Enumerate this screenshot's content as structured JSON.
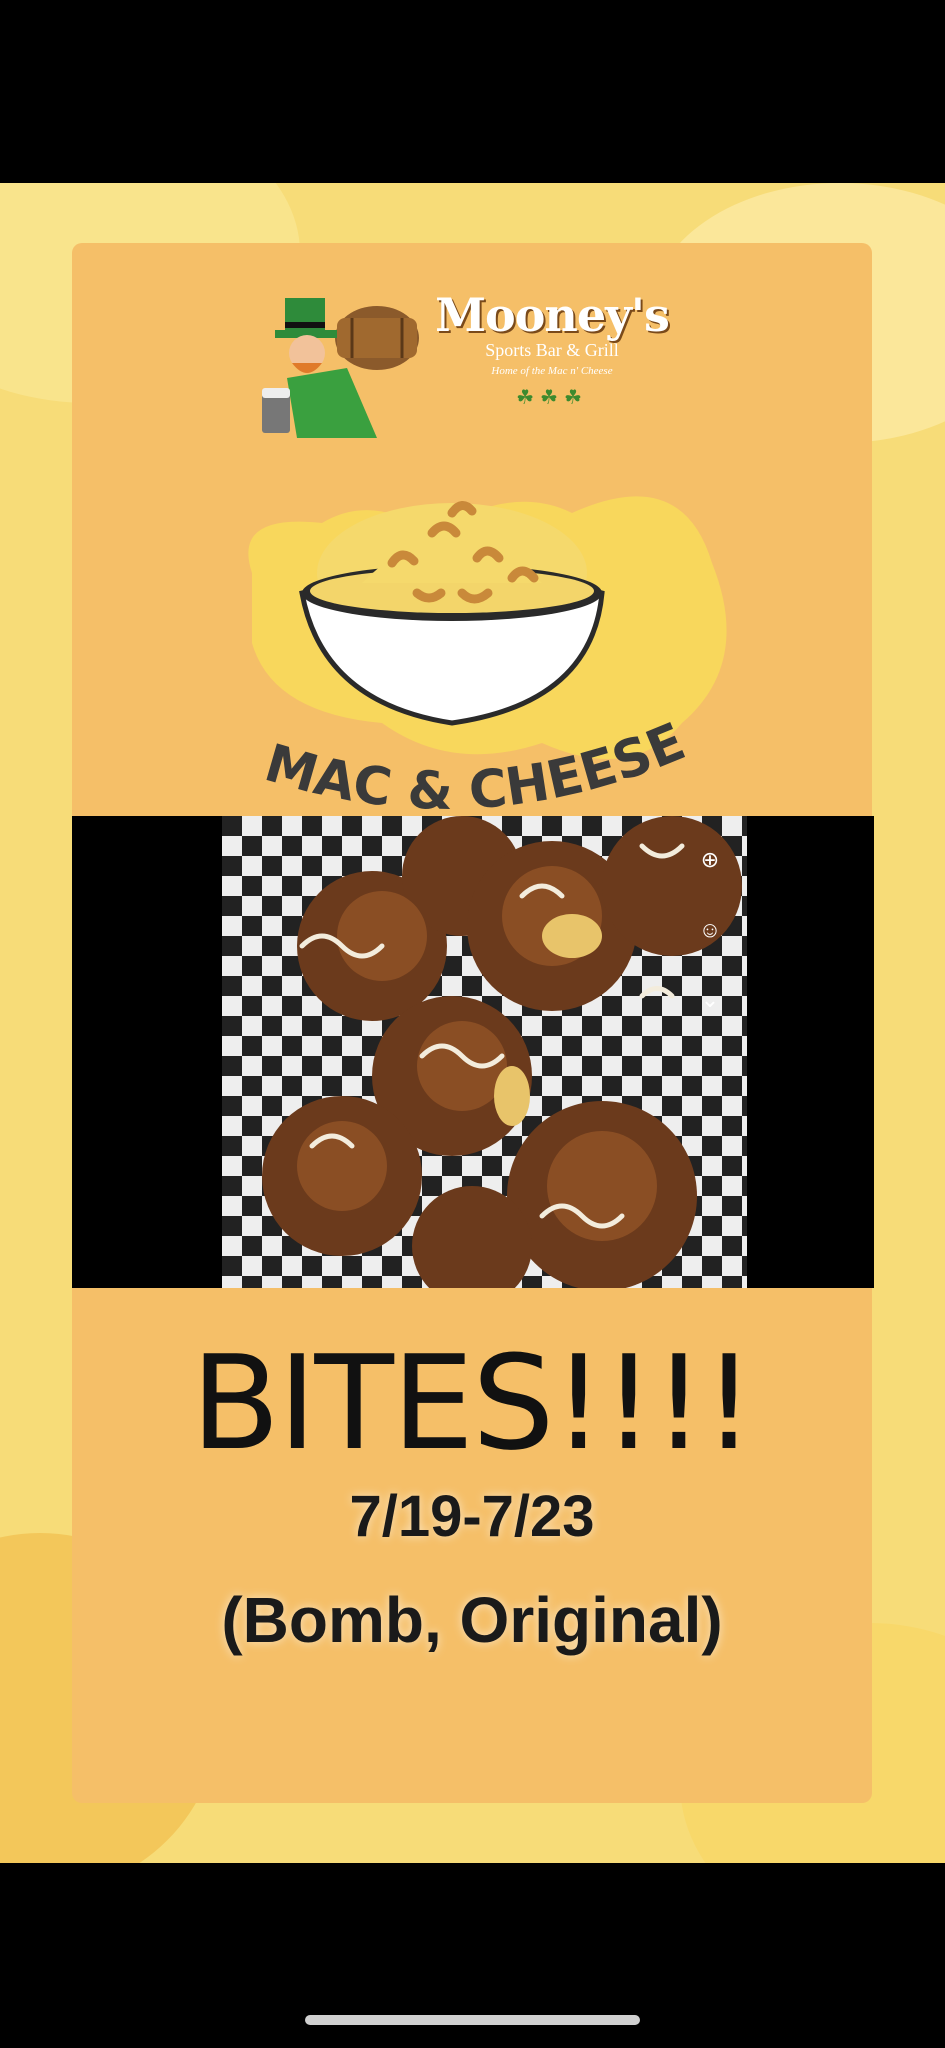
{
  "brand": {
    "name": "Mooney's",
    "subtitle": "Sports Bar & Grill",
    "tagline": "Home of the Mac n' Cheese",
    "clovers": "☘☘☘"
  },
  "promo": {
    "headline": "MAC & CHEESE",
    "item": "BITES!!!!",
    "dates": "7/19-7/23",
    "variants": "(Bomb, Original)"
  },
  "icons": {
    "photo_side": [
      "effects-icon",
      "add-sticker-icon",
      "chevron-down-icon"
    ]
  },
  "colors": {
    "background": "#f7dc78",
    "card": "#f5bf68",
    "text": "#1a1a1a"
  }
}
